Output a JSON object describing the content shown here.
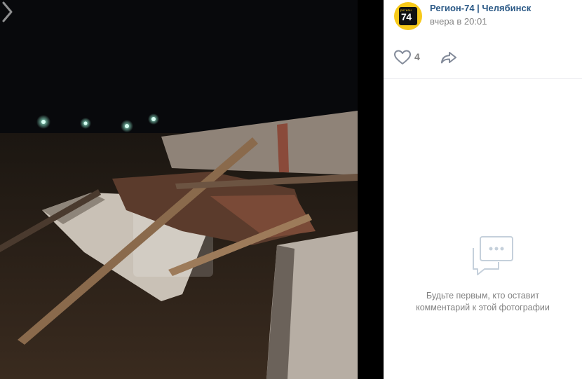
{
  "post": {
    "group_name": "Регион-74 | Челябинск",
    "time": "вчера в 20:01",
    "avatar_small_text": "регион",
    "avatar_number": "74"
  },
  "actions": {
    "like_icon": "heart-icon",
    "like_count": "4",
    "share_icon": "share-arrow-icon"
  },
  "comments": {
    "empty_icon": "comment-bubble-icon",
    "empty_line1": "Будьте первым, кто оставит",
    "empty_line2": "комментарий к этой фотографии"
  },
  "photo": {
    "watermark_icon": "region-74-watermark",
    "next_icon": "chevron-right-icon"
  },
  "colors": {
    "link": "#2a5885",
    "muted": "#828282",
    "brand": "#f7c91a"
  }
}
